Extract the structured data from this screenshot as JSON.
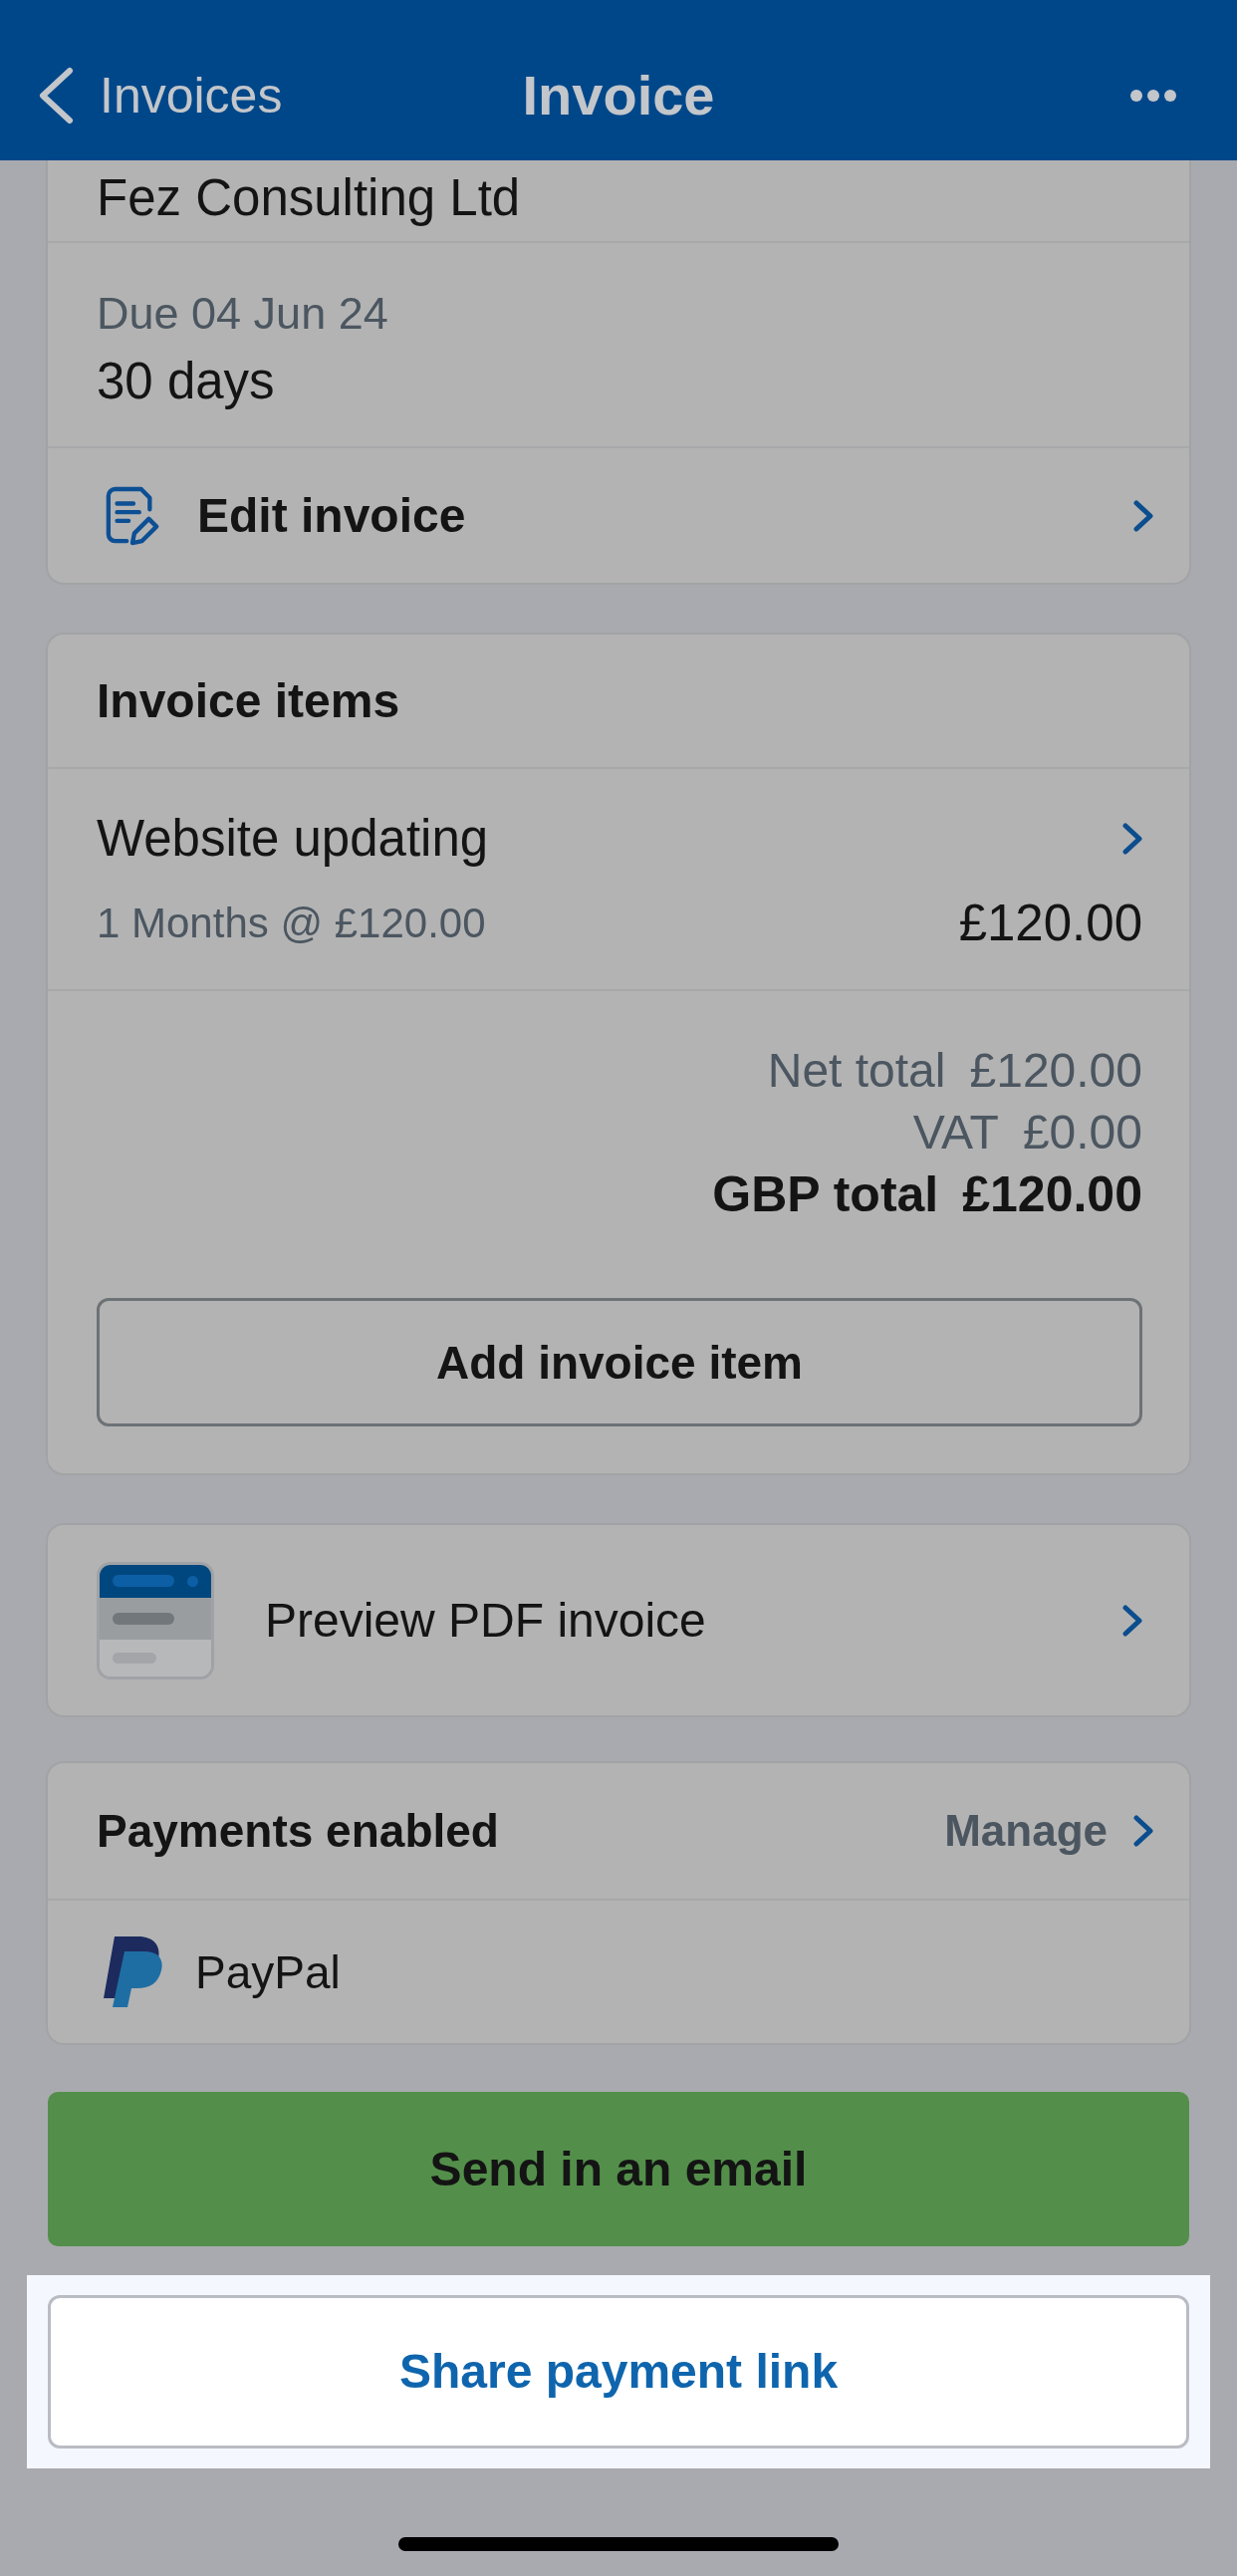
{
  "nav": {
    "back_label": "Invoices",
    "title": "Invoice"
  },
  "client": {
    "name": "Fez Consulting Ltd",
    "due": "Due 04 Jun 24",
    "terms": "30 days",
    "edit_label": "Edit invoice"
  },
  "invoice_items": {
    "title": "Invoice items",
    "items": [
      {
        "name": "Website updating",
        "detail": "1 Months @ £120.00",
        "amount": "£120.00"
      }
    ],
    "totals": [
      {
        "label": "Net total",
        "value": "£120.00",
        "kind": "subtotal"
      },
      {
        "label": "VAT",
        "value": "£0.00",
        "kind": "subtotal"
      },
      {
        "label": "GBP total",
        "value": "£120.00",
        "kind": "grand"
      }
    ],
    "add_button": "Add invoice item"
  },
  "preview": {
    "label": "Preview PDF invoice"
  },
  "payments": {
    "title": "Payments enabled",
    "manage_label": "Manage",
    "methods": [
      {
        "name": "PayPal"
      }
    ]
  },
  "actions": [
    {
      "label": "Send in an email",
      "kind": "primary",
      "highlighted": false
    },
    {
      "label": "Share payment link",
      "kind": "secondary",
      "highlighted": true
    }
  ]
}
